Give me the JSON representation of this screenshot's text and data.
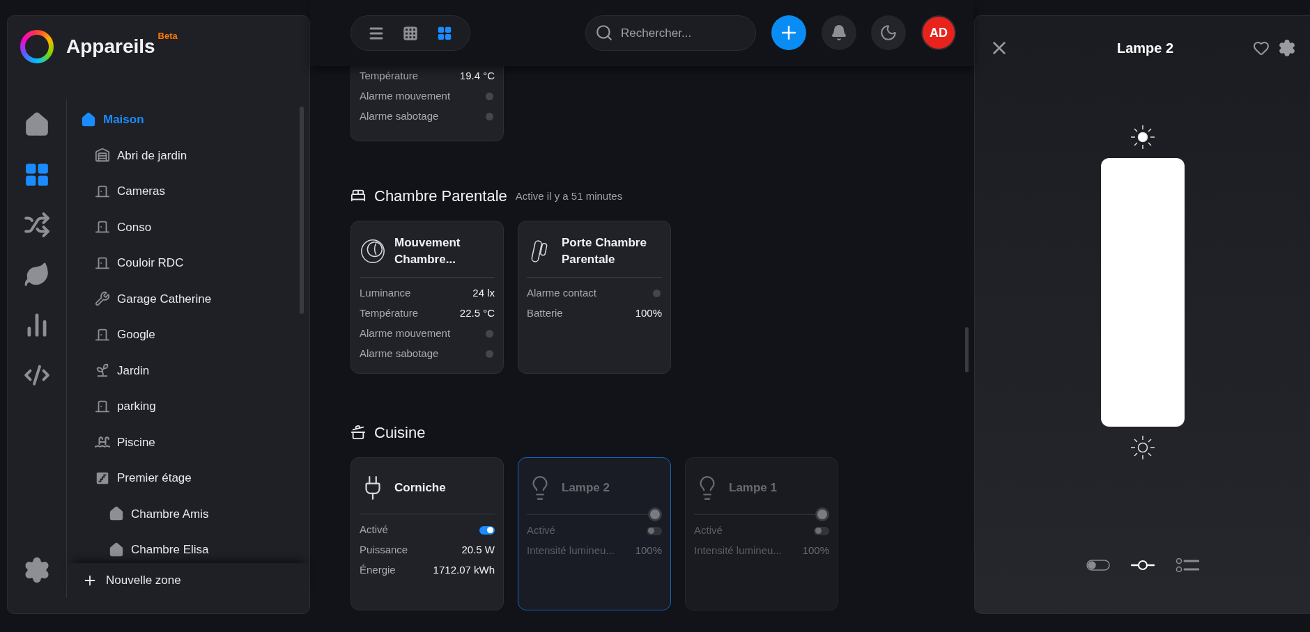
{
  "app": {
    "title": "Appareils",
    "badge": "Beta"
  },
  "nav": [
    {
      "kind": "home",
      "selected": false
    },
    {
      "kind": "devices",
      "selected": true
    },
    {
      "kind": "scenes",
      "selected": false
    },
    {
      "kind": "energy",
      "selected": false
    },
    {
      "kind": "stats",
      "selected": false
    },
    {
      "kind": "code",
      "selected": false
    }
  ],
  "tree": {
    "label": "Maison",
    "kind": "house",
    "selected": true,
    "children": [
      {
        "label": "Abri de jardin",
        "kind": "barn",
        "selected": false
      },
      {
        "label": "Cameras",
        "kind": "door",
        "selected": false
      },
      {
        "label": "Conso",
        "kind": "door",
        "selected": false
      },
      {
        "label": "Couloir RDC",
        "kind": "door",
        "selected": false
      },
      {
        "label": "Garage Catherine",
        "kind": "tools",
        "selected": false
      },
      {
        "label": "Google",
        "kind": "door",
        "selected": false
      },
      {
        "label": "Jardin",
        "kind": "plant",
        "selected": false
      },
      {
        "label": "parking",
        "kind": "door",
        "selected": false
      },
      {
        "label": "Piscine",
        "kind": "pool",
        "selected": false
      },
      {
        "label": "Premier étage",
        "kind": "stairs",
        "selected": false,
        "children": [
          {
            "label": "Chambre Amis",
            "kind": "house",
            "selected": false
          },
          {
            "label": "Chambre Elisa",
            "kind": "house",
            "selected": false
          }
        ]
      }
    ]
  },
  "new_zone": "Nouvelle zone",
  "view_modes": [
    {
      "kind": "list",
      "selected": false
    },
    {
      "kind": "grid",
      "selected": false
    },
    {
      "kind": "tiles",
      "selected": true
    }
  ],
  "search": {
    "placeholder": "Rechercher..."
  },
  "avatar": "AD",
  "partial_card": {
    "rows": [
      {
        "kind": "value",
        "label": "Température",
        "value": "19.4 °C"
      },
      {
        "kind": "dot",
        "label": "Alarme mouvement",
        "on": false
      },
      {
        "kind": "dot",
        "label": "Alarme sabotage",
        "on": false
      }
    ]
  },
  "sections": [
    {
      "title": "Chambre Parentale",
      "kind": "bed",
      "subtitle": "Active il y a 51 minutes",
      "cards": [
        {
          "title": "Mouvement Chambre...",
          "kind": "motion",
          "selected": false,
          "disabled": false,
          "rows": [
            {
              "kind": "value",
              "label": "Luminance",
              "value": "24 lx"
            },
            {
              "kind": "value",
              "label": "Température",
              "value": "22.5 °C"
            },
            {
              "kind": "dot",
              "label": "Alarme mouvement",
              "on": false
            },
            {
              "kind": "dot",
              "label": "Alarme sabotage",
              "on": false
            }
          ]
        },
        {
          "title": "Porte Chambre Parentale",
          "kind": "contact",
          "selected": false,
          "disabled": false,
          "rows": [
            {
              "kind": "dot",
              "label": "Alarme contact",
              "on": false
            },
            {
              "kind": "value",
              "label": "Batterie",
              "value": "100%"
            }
          ]
        }
      ]
    },
    {
      "title": "Cuisine",
      "kind": "pot",
      "cards": [
        {
          "title": "Corniche",
          "kind": "plug",
          "selected": false,
          "disabled": false,
          "rows": [
            {
              "kind": "toggle",
              "label": "Activé",
              "on": true
            },
            {
              "kind": "value",
              "label": "Puissance",
              "value": "20.5 W"
            },
            {
              "kind": "value",
              "label": "Énergie",
              "value": "1712.07 kWh"
            }
          ]
        },
        {
          "title": "Lampe 2",
          "kind": "lamp",
          "selected": true,
          "disabled": true,
          "level": 1,
          "rows": [
            {
              "kind": "toggle",
              "label": "Activé",
              "on": false
            },
            {
              "kind": "value",
              "label": "Intensité lumineu...",
              "value": "100%"
            }
          ]
        },
        {
          "title": "Lampe 1",
          "kind": "lamp",
          "selected": false,
          "disabled": true,
          "level": 1,
          "rows": [
            {
              "kind": "toggle",
              "label": "Activé",
              "on": false
            },
            {
              "kind": "value",
              "label": "Intensité lumineu...",
              "value": "100%"
            }
          ]
        }
      ]
    }
  ],
  "detail": {
    "title": "Lampe 2",
    "level": 1,
    "modes": [
      {
        "kind": "toggle",
        "selected": false
      },
      {
        "kind": "slider",
        "selected": true
      },
      {
        "kind": "list",
        "selected": false
      }
    ]
  }
}
